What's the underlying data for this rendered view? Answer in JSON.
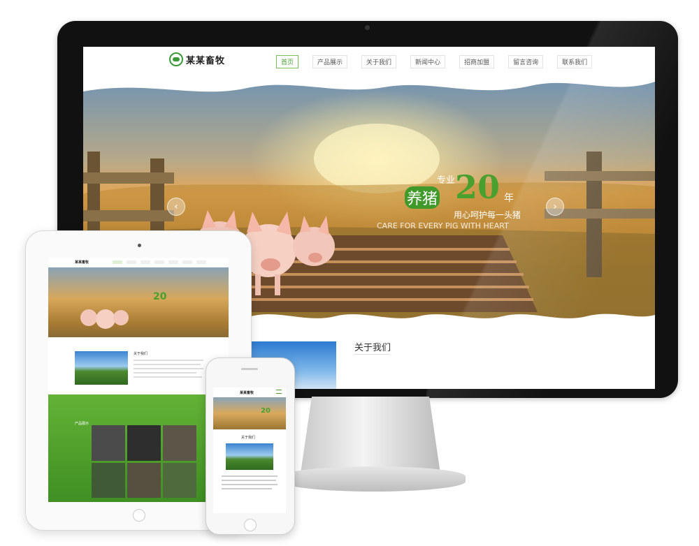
{
  "brand": {
    "name": "某某畜牧"
  },
  "nav": [
    {
      "label": "首页",
      "active": true
    },
    {
      "label": "产品展示",
      "active": false
    },
    {
      "label": "关于我们",
      "active": false
    },
    {
      "label": "新闻中心",
      "active": false
    },
    {
      "label": "招商加盟",
      "active": false
    },
    {
      "label": "留言咨询",
      "active": false
    },
    {
      "label": "联系我们",
      "active": false
    }
  ],
  "hero": {
    "pre": "专业",
    "main": "养猪",
    "number": "20",
    "suffix": "年",
    "subtitle": "用心呵护每一头猪",
    "english": "CARE FOR EVERY PIG WITH HEART",
    "prev_icon": "chevron-left-icon",
    "next_icon": "chevron-right-icon"
  },
  "about": {
    "title": "关于我们"
  },
  "tablet": {
    "about_title": "关于我们",
    "products_label": "产品展示"
  },
  "phone": {
    "about_title": "关于我们"
  },
  "colors": {
    "brand_green": "#4aa02e",
    "nav_active_border": "#7cbf5a"
  }
}
